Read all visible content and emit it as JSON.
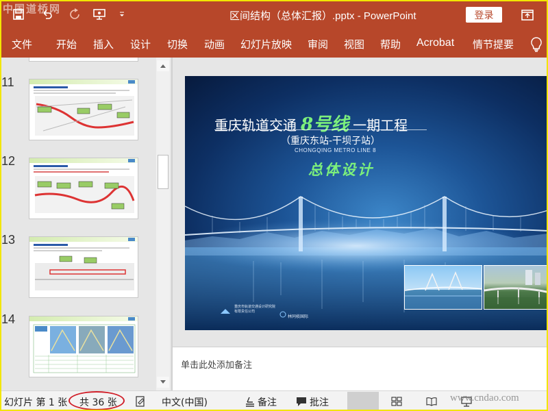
{
  "watermark": {
    "top_left": "中国道桥网",
    "bottom_right": "www.cndao.com"
  },
  "titlebar": {
    "document_title": "区间结构（总体汇报）.pptx  -  PowerPoint",
    "login_label": "登录",
    "icons": [
      "save-icon",
      "undo-icon",
      "redo-icon",
      "present-icon",
      "customize-qat-icon",
      "ribbon-display-icon"
    ]
  },
  "ribbon": {
    "tabs": [
      "文件",
      "开始",
      "插入",
      "设计",
      "切换",
      "动画",
      "幻灯片放映",
      "审阅",
      "视图",
      "帮助",
      "Acrobat",
      "情节提要"
    ],
    "tell_me_icon": "lightbulb-icon"
  },
  "thumbnails": [
    {
      "number": "11"
    },
    {
      "number": "12"
    },
    {
      "number": "13"
    },
    {
      "number": "14"
    }
  ],
  "slide": {
    "title_prefix": "重庆轨道交通",
    "title_line": "8号线",
    "title_suffix": "一期工程",
    "subtitle": "（重庆东站-干坝子站）",
    "english": "CHONGQING METRO LINE 8",
    "design_label": "总体设计",
    "org_lines": [
      "重庆市轨道交通设计研究院",
      "有限责任公司"
    ],
    "partner_label": "林同棪国际"
  },
  "notes": {
    "placeholder": "单击此处添加备注"
  },
  "statusbar": {
    "slide_label": "幻灯片 第 1 张",
    "total_label": "共 36 张",
    "language": "中文(中国)",
    "notes_label": "备注",
    "comments_label": "批注"
  },
  "colors": {
    "ribbon": "#b7472a",
    "highlight": "#d0202a",
    "slide_green": "#7cf07c"
  }
}
